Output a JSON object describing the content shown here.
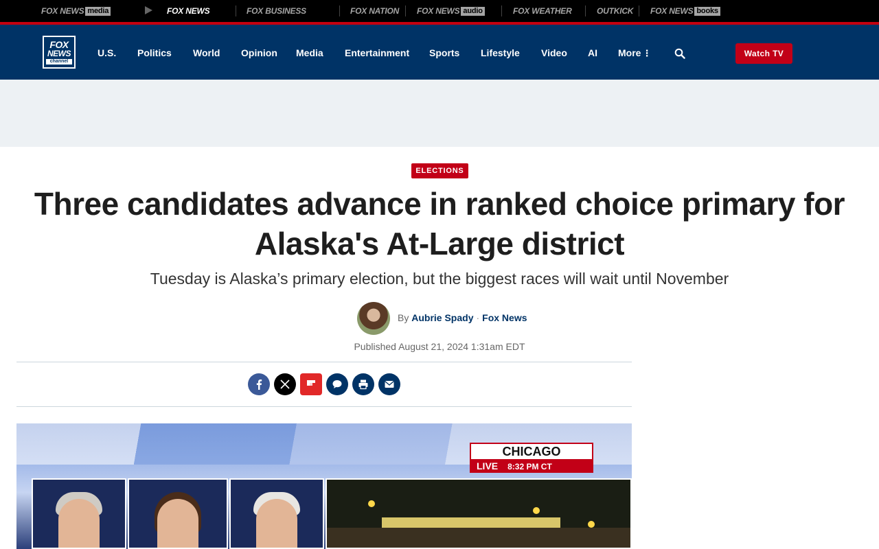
{
  "network_bar": {
    "brands": [
      {
        "name": "FOX NEWS",
        "suffix": "media"
      },
      {
        "name": "FOX NEWS",
        "suffix": ""
      },
      {
        "name": "FOX BUSINESS",
        "suffix": ""
      },
      {
        "name": "FOX NATION",
        "suffix": ""
      },
      {
        "name": "FOX NEWS",
        "suffix": "audio"
      },
      {
        "name": "FOX WEATHER",
        "suffix": ""
      },
      {
        "name": "OUTKICK",
        "suffix": ""
      },
      {
        "name": "FOX NEWS",
        "suffix": "books"
      }
    ]
  },
  "header": {
    "logo": {
      "line1": "FOX",
      "line2": "NEWS",
      "line3": "channel"
    },
    "nav": [
      "U.S.",
      "Politics",
      "World",
      "Opinion",
      "Media",
      "Entertainment",
      "Sports",
      "Lifestyle",
      "Video",
      "AI",
      "More"
    ],
    "search_icon": "search-icon",
    "watch_tv_label": "Watch TV"
  },
  "article": {
    "eyebrow": "ELECTIONS",
    "headline": "Three candidates advance in ranked choice primary for Alaska's At-Large district",
    "subhead": "Tuesday is Alaska’s primary election, but the biggest races will wait until November",
    "byline": {
      "prefix": "By",
      "author": "Aubrie Spady",
      "separator": "·",
      "source": "Fox News"
    },
    "published": "Published August 21, 2024 1:31am EDT",
    "share": [
      {
        "icon": "facebook-icon",
        "color": "#3b5998"
      },
      {
        "icon": "x-icon",
        "color": "#000000"
      },
      {
        "icon": "flipboard-icon",
        "color": "#e12828"
      },
      {
        "icon": "comment-icon",
        "color": "#003366"
      },
      {
        "icon": "print-icon",
        "color": "#003366"
      },
      {
        "icon": "email-icon",
        "color": "#003366"
      }
    ],
    "hero": {
      "location": "CHICAGO",
      "live_label": "LIVE",
      "time": "8:32 PM CT"
    }
  },
  "colors": {
    "brand_navy": "#003366",
    "accent_red": "#c20017",
    "ad_band": "#edf1f4"
  }
}
